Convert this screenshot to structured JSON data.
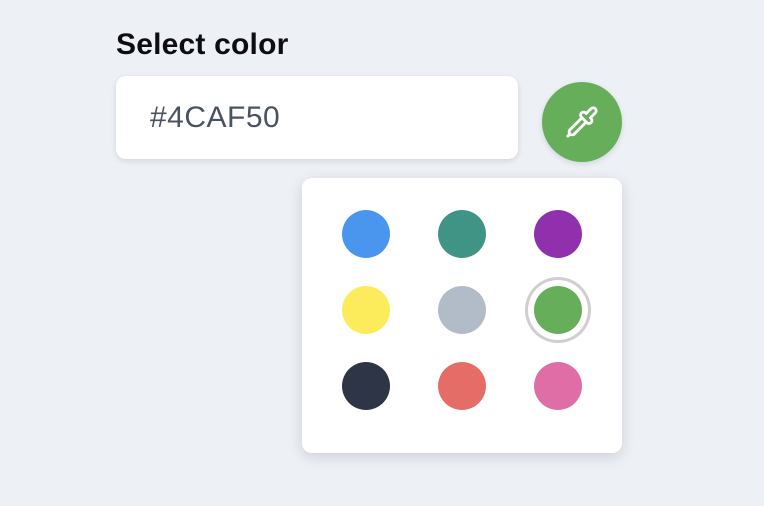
{
  "label": "Select color",
  "input": {
    "value": "#4CAF50"
  },
  "eyedropper": {
    "icon": "eyedropper-icon",
    "color": "#66ae5a"
  },
  "palette": {
    "selected_index": 5,
    "swatches": [
      {
        "name": "swatch-blue",
        "color": "#4a96ee"
      },
      {
        "name": "swatch-teal",
        "color": "#409485"
      },
      {
        "name": "swatch-purple",
        "color": "#9030ac"
      },
      {
        "name": "swatch-yellow",
        "color": "#fcec5c"
      },
      {
        "name": "swatch-gray",
        "color": "#b2bcc8"
      },
      {
        "name": "swatch-green",
        "color": "#66ae5a"
      },
      {
        "name": "swatch-dark",
        "color": "#2e3546"
      },
      {
        "name": "swatch-red",
        "color": "#e66c68"
      },
      {
        "name": "swatch-pink",
        "color": "#e06ea6"
      }
    ]
  }
}
